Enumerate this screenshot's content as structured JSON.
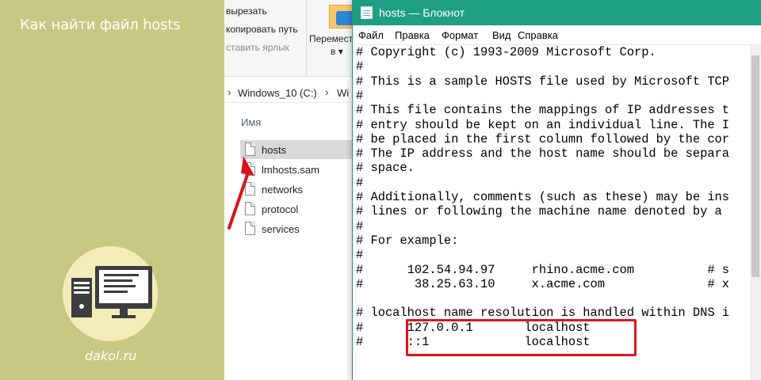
{
  "article": {
    "title": "Как найти файл hosts",
    "site": "dakol.ru",
    "logo_icon": "computer-icon",
    "panel_color": "#c9c883"
  },
  "explorer": {
    "ribbon": {
      "cut": "вырезать",
      "copy_path": "копировать путь",
      "paste_shortcut": "ставить ярлык",
      "move_to_line1": "Перемести",
      "move_to_line2": "в ▾"
    },
    "breadcrumb": {
      "drive": "Windows_10 (C:)",
      "next": "Wi"
    },
    "column_header": "Имя",
    "files": [
      {
        "name": "hosts",
        "selected": true
      },
      {
        "name": "lmhosts.sam",
        "selected": false
      },
      {
        "name": "networks",
        "selected": false
      },
      {
        "name": "protocol",
        "selected": false
      },
      {
        "name": "services",
        "selected": false
      }
    ]
  },
  "notepad": {
    "title": "hosts — Блокнот",
    "menu": [
      {
        "label": "Файл"
      },
      {
        "label": "Правка"
      },
      {
        "label": "Формат"
      },
      {
        "label": "Вид"
      },
      {
        "label": "Справка"
      }
    ],
    "lines": [
      "# Copyright (c) 1993-2009 Microsoft Corp.",
      "#",
      "# This is a sample HOSTS file used by Microsoft TCP",
      "#",
      "# This file contains the mappings of IP addresses t",
      "# entry should be kept on an individual line. The I",
      "# be placed in the first column followed by the cor",
      "# The IP address and the host name should be separa",
      "# space.",
      "#",
      "# Additionally, comments (such as these) may be ins",
      "# lines or following the machine name denoted by a",
      "#",
      "# For example:",
      "#",
      "#      102.54.94.97     rhino.acme.com          # s",
      "#       38.25.63.10     x.acme.com              # x",
      "",
      "# localhost name resolution is handled within DNS i",
      "#      127.0.0.1       localhost",
      "#      ::1             localhost"
    ],
    "titlebar_color": "#1f9e86",
    "highlight_color": "#e0141e"
  }
}
